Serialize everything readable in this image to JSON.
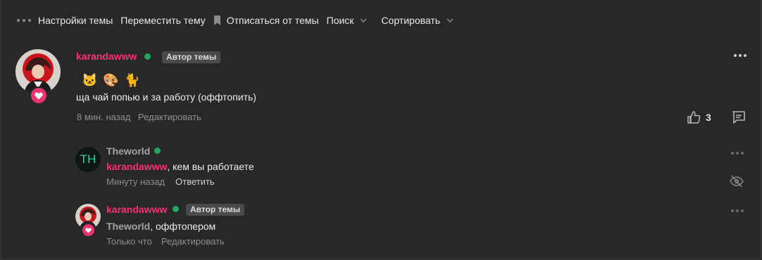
{
  "toolbar": {
    "theme_settings": "Настройки темы",
    "move_theme": "Переместить тему",
    "unsubscribe": "Отписаться от темы",
    "search": "Поиск",
    "sort": "Сортировать"
  },
  "post": {
    "author": "karandawww",
    "author_badge": "Автор темы",
    "emojis": [
      "🐱",
      "🎨",
      "🐈"
    ],
    "text": "ща чай попью и за работу (оффтопить)",
    "time": "8 мин. назад",
    "edit": "Редактировать",
    "likes": "3"
  },
  "replies": [
    {
      "author": "Theworld",
      "avatar_initials": "TH",
      "mention": "karandawww",
      "text": ", кем вы работаете",
      "time": "Минуту назад",
      "action": "Ответить"
    },
    {
      "author": "karandawww",
      "author_badge": "Автор темы",
      "mention": "Theworld",
      "text": ", оффтопером",
      "time": "Только что",
      "action": "Редактировать"
    }
  ],
  "colors": {
    "background": "#282828",
    "username": "#ff2f78",
    "online": "#1fa763",
    "badge_bg": "#4a4a4a",
    "heart": "#e8336f"
  }
}
